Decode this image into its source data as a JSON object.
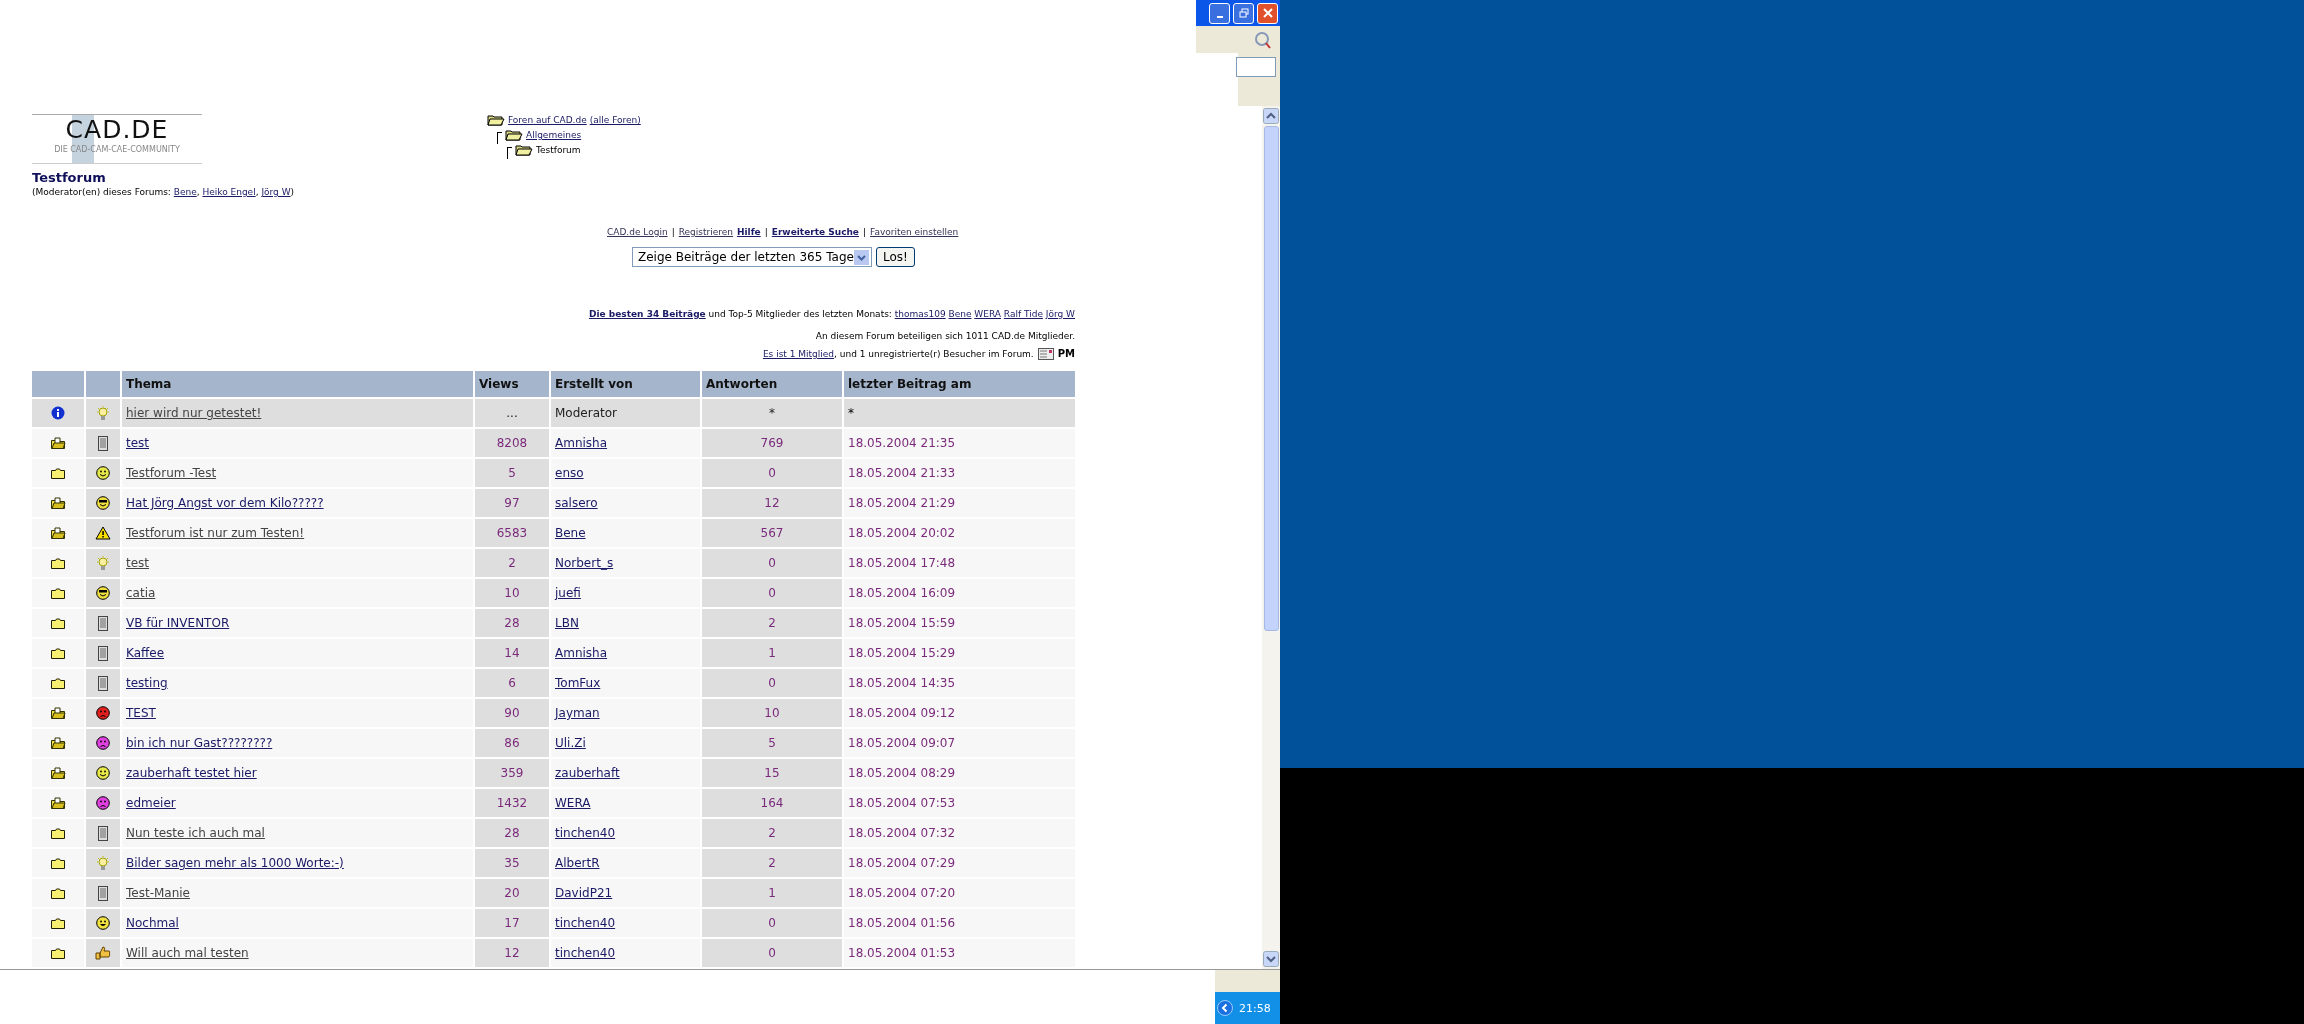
{
  "logo": {
    "name": "CAD.DE",
    "tagline": "DIE CAD-CAM-CAE-COMMUNITY"
  },
  "breadcrumb": {
    "label": "Foren auf CAD.de",
    "extra": "(alle Foren)",
    "current": false,
    "children": [
      {
        "label": "Allgemeines",
        "current": false,
        "children": [
          {
            "label": "Testforum",
            "current": true
          }
        ]
      }
    ]
  },
  "forum": {
    "title": "Testforum",
    "moderators_prefix": "(Moderator(en) dieses Forums: ",
    "moderators": [
      "Bene",
      "Heiko Engel",
      "Jörg W"
    ],
    "moderators_separator": ", ",
    "moderators_suffix": ")"
  },
  "nav": [
    {
      "kind": "link",
      "label": "CAD.de Login",
      "strong": false
    },
    {
      "kind": "separator",
      "label": "|"
    },
    {
      "kind": "link",
      "label": "Registrieren",
      "strong": false
    },
    {
      "kind": "link",
      "label": "Hilfe",
      "strong": true
    },
    {
      "kind": "separator",
      "label": "|"
    },
    {
      "kind": "link",
      "label": "Erweiterte Suche",
      "strong": true
    },
    {
      "kind": "separator",
      "label": "|"
    },
    {
      "kind": "link",
      "label": "Favoriten einstellen",
      "strong": false
    }
  ],
  "period": {
    "value": "Zeige Beiträge der letzten 365 Tage",
    "button": "Los!"
  },
  "top_line": {
    "best_link": "Die besten 34 Beiträge",
    "text": " und Top-5 Mitglieder des letzten Monats: ",
    "members": [
      "thomas109",
      "Bene",
      "WERA",
      "Ralf Tide",
      "Jörg W"
    ]
  },
  "members_line": "An diesem Forum beteiligen sich 1011 CAD.de Mitglieder.",
  "online_line": {
    "link": "Es ist 1 Mitglied",
    "text": ", und 1 unregistrierte(r) Besucher im Forum.",
    "pm": "PM"
  },
  "table": {
    "columns": [
      "Thema",
      "Views",
      "Erstellt von",
      "Antworten",
      "letzter Beitrag am"
    ],
    "rows": [
      {
        "kind": "announcement",
        "status_icon": {
          "kind": "info"
        },
        "topic_icon": {
          "kind": "lightbulb"
        },
        "topic": "hier wird nur getestet!",
        "visited": true,
        "views": "...",
        "author": "Moderator",
        "author_link": false,
        "replies": "*",
        "last": "*"
      },
      {
        "kind": "topic",
        "status_icon": {
          "kind": "hot"
        },
        "topic_icon": {
          "kind": "document"
        },
        "topic": "test",
        "visited": false,
        "views": "8208",
        "author": "Amnisha",
        "author_link": true,
        "replies": "769",
        "last": "18.05.2004 21:35"
      },
      {
        "kind": "topic",
        "status_icon": {
          "kind": "folder"
        },
        "topic_icon": {
          "kind": "smile"
        },
        "topic": "Testforum -Test",
        "visited": true,
        "views": "5",
        "author": "enso",
        "author_link": true,
        "replies": "0",
        "last": "18.05.2004 21:33"
      },
      {
        "kind": "topic",
        "status_icon": {
          "kind": "hot"
        },
        "topic_icon": {
          "kind": "cool"
        },
        "topic": "Hat Jörg Angst vor dem Kilo?????",
        "visited": false,
        "views": "97",
        "author": "salsero",
        "author_link": true,
        "replies": "12",
        "last": "18.05.2004 21:29"
      },
      {
        "kind": "topic",
        "status_icon": {
          "kind": "hot"
        },
        "topic_icon": {
          "kind": "warning"
        },
        "topic": "Testforum ist nur zum Testen!",
        "visited": true,
        "views": "6583",
        "author": "Bene",
        "author_link": true,
        "replies": "567",
        "last": "18.05.2004 20:02"
      },
      {
        "kind": "topic",
        "status_icon": {
          "kind": "folder"
        },
        "topic_icon": {
          "kind": "lightbulb"
        },
        "topic": "test",
        "visited": true,
        "views": "2",
        "author": "Norbert_s",
        "author_link": true,
        "replies": "0",
        "last": "18.05.2004 17:48"
      },
      {
        "kind": "topic",
        "status_icon": {
          "kind": "folder"
        },
        "topic_icon": {
          "kind": "cool"
        },
        "topic": "catia",
        "visited": true,
        "views": "10",
        "author": "juefi",
        "author_link": true,
        "replies": "0",
        "last": "18.05.2004 16:09"
      },
      {
        "kind": "topic",
        "status_icon": {
          "kind": "folder"
        },
        "topic_icon": {
          "kind": "document"
        },
        "topic": "VB für INVENTOR",
        "visited": false,
        "views": "28",
        "author": "LBN",
        "author_link": true,
        "replies": "2",
        "last": "18.05.2004 15:59"
      },
      {
        "kind": "topic",
        "status_icon": {
          "kind": "folder"
        },
        "topic_icon": {
          "kind": "document"
        },
        "topic": "Kaffee",
        "visited": false,
        "views": "14",
        "author": "Amnisha",
        "author_link": true,
        "replies": "1",
        "last": "18.05.2004 15:29"
      },
      {
        "kind": "topic",
        "status_icon": {
          "kind": "folder"
        },
        "topic_icon": {
          "kind": "document"
        },
        "topic": "testing",
        "visited": false,
        "views": "6",
        "author": "TomFux",
        "author_link": true,
        "replies": "0",
        "last": "18.05.2004 14:35"
      },
      {
        "kind": "topic",
        "status_icon": {
          "kind": "hot"
        },
        "topic_icon": {
          "kind": "angry"
        },
        "topic": "TEST",
        "visited": false,
        "views": "90",
        "author": "Jayman",
        "author_link": true,
        "replies": "10",
        "last": "18.05.2004 09:12"
      },
      {
        "kind": "topic",
        "status_icon": {
          "kind": "hot"
        },
        "topic_icon": {
          "kind": "sad"
        },
        "topic": "bin ich nur Gast????????",
        "visited": false,
        "views": "86",
        "author": "Uli.Zi",
        "author_link": true,
        "replies": "5",
        "last": "18.05.2004 09:07"
      },
      {
        "kind": "topic",
        "status_icon": {
          "kind": "hot"
        },
        "topic_icon": {
          "kind": "smile"
        },
        "topic": "zauberhaft testet hier",
        "visited": false,
        "views": "359",
        "author": "zauberhaft",
        "author_link": true,
        "replies": "15",
        "last": "18.05.2004 08:29"
      },
      {
        "kind": "topic",
        "status_icon": {
          "kind": "hot"
        },
        "topic_icon": {
          "kind": "sad"
        },
        "topic": "edmeier",
        "visited": false,
        "views": "1432",
        "author": "WERA",
        "author_link": true,
        "replies": "164",
        "last": "18.05.2004 07:53"
      },
      {
        "kind": "topic",
        "status_icon": {
          "kind": "folder"
        },
        "topic_icon": {
          "kind": "document"
        },
        "topic": "Nun teste ich auch mal",
        "visited": true,
        "views": "28",
        "author": "tinchen40",
        "author_link": true,
        "replies": "2",
        "last": "18.05.2004 07:32"
      },
      {
        "kind": "topic",
        "status_icon": {
          "kind": "folder"
        },
        "topic_icon": {
          "kind": "lightbulb"
        },
        "topic": "Bilder sagen mehr als 1000 Worte:-)",
        "visited": false,
        "views": "35",
        "author": "AlbertR",
        "author_link": true,
        "replies": "2",
        "last": "18.05.2004 07:29"
      },
      {
        "kind": "topic",
        "status_icon": {
          "kind": "folder"
        },
        "topic_icon": {
          "kind": "document"
        },
        "topic": "Test-Manie",
        "visited": true,
        "views": "20",
        "author": "DavidP21",
        "author_link": true,
        "replies": "1",
        "last": "18.05.2004 07:20"
      },
      {
        "kind": "topic",
        "status_icon": {
          "kind": "folder"
        },
        "topic_icon": {
          "kind": "grin"
        },
        "topic": "Nochmal",
        "visited": false,
        "views": "17",
        "author": "tinchen40",
        "author_link": true,
        "replies": "0",
        "last": "18.05.2004 01:56"
      },
      {
        "kind": "topic",
        "status_icon": {
          "kind": "folder"
        },
        "topic_icon": {
          "kind": "thumbs"
        },
        "topic": "Will auch mal testen",
        "visited": true,
        "views": "12",
        "author": "tinchen40",
        "author_link": true,
        "replies": "0",
        "last": "18.05.2004 01:53"
      }
    ]
  },
  "taskbar": {
    "clock": "21:58"
  }
}
